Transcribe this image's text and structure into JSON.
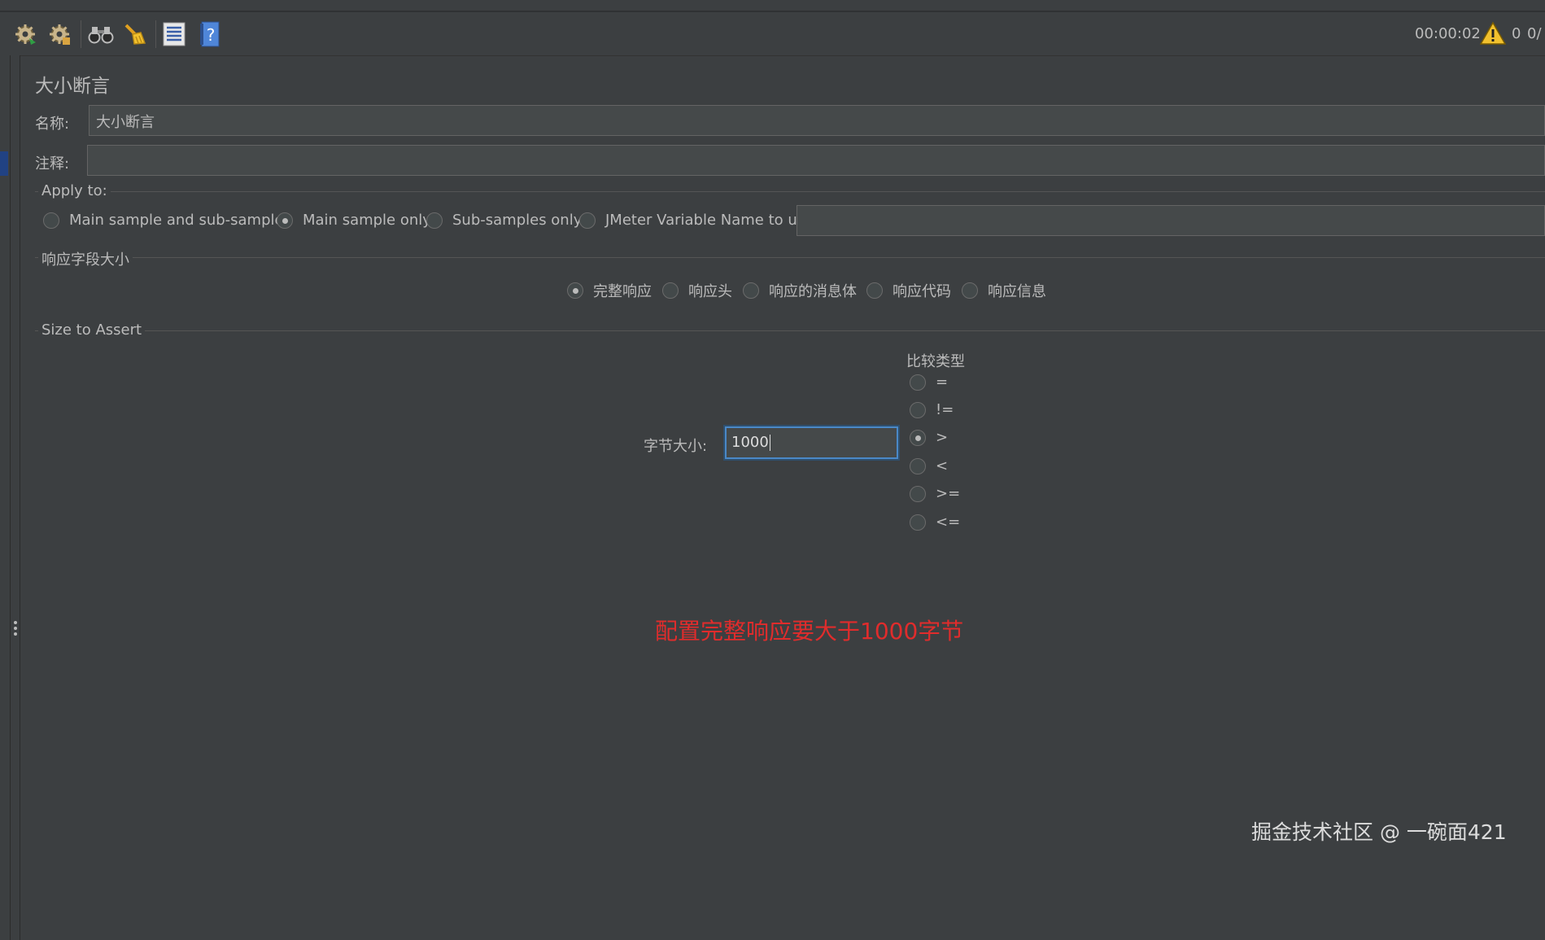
{
  "toolbar": {
    "icons": [
      "gear-run-icon",
      "gear-stop-icon",
      "binoculars-icon",
      "broom-icon",
      "list-icon",
      "help-icon"
    ],
    "elapsed": "00:00:02",
    "warning_count": "0",
    "threads": "0/"
  },
  "panel": {
    "title": "大小断言",
    "name_label": "名称:",
    "name_value": "大小断言",
    "comment_label": "注释:",
    "comment_value": ""
  },
  "apply_to": {
    "title": "Apply to:",
    "options": [
      "Main sample and sub-samples",
      "Main sample only",
      "Sub-samples only",
      "JMeter Variable Name to use"
    ],
    "selected": "Main sample only",
    "variable_value": ""
  },
  "response_field": {
    "title": "响应字段大小",
    "options": [
      "完整响应",
      "响应头",
      "响应的消息体",
      "响应代码",
      "响应信息"
    ],
    "selected": "完整响应"
  },
  "size_to_assert": {
    "title": "Size to Assert",
    "byte_size_label": "字节大小:",
    "byte_size_value": "1000",
    "comparison_title": "比较类型",
    "comparison_options": [
      "=",
      "!=",
      ">",
      "<",
      ">=",
      "<="
    ],
    "comparison_selected": ">"
  },
  "annotation_text": "配置完整响应要大于1000字节",
  "watermark": "掘金技术社区 @ 一碗面421",
  "colors": {
    "background": "#3c3f41",
    "field_bg": "#45494a",
    "focus_border": "#4a88c7",
    "annotation": "#e02c2c",
    "warning": "#f2c12e"
  }
}
